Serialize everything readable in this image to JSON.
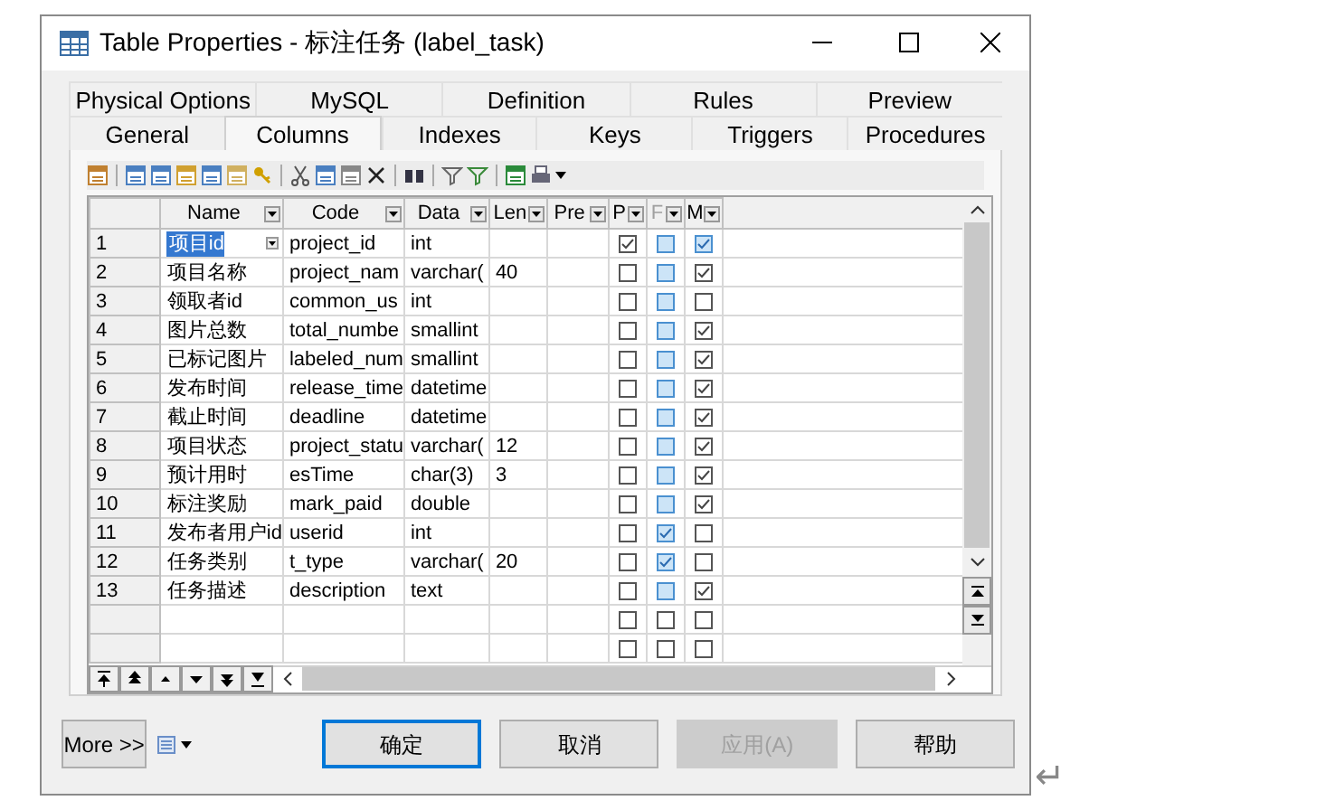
{
  "window": {
    "title": "Table Properties - 标注任务 (label_task)"
  },
  "tabs": [
    [
      {
        "label": "Physical Options",
        "selected": false
      },
      {
        "label": "MySQL",
        "selected": false
      },
      {
        "label": "Definition",
        "selected": false
      },
      {
        "label": "Rules",
        "selected": false
      },
      {
        "label": "Preview",
        "selected": false
      }
    ],
    [
      {
        "label": "General",
        "selected": false
      },
      {
        "label": "Columns",
        "selected": true
      },
      {
        "label": "Indexes",
        "selected": false
      },
      {
        "label": "Keys",
        "selected": false
      },
      {
        "label": "Triggers",
        "selected": false
      },
      {
        "label": "Procedures",
        "selected": false
      }
    ]
  ],
  "table": {
    "columns": [
      {
        "label": "Name",
        "disabled": false
      },
      {
        "label": "Code",
        "disabled": false
      },
      {
        "label": "Data",
        "disabled": false
      },
      {
        "label": "Len",
        "disabled": false
      },
      {
        "label": "Pre",
        "disabled": false
      },
      {
        "label": "P",
        "disabled": false
      },
      {
        "label": "F",
        "disabled": true
      },
      {
        "label": "M",
        "disabled": false
      }
    ],
    "rows": [
      {
        "number": "1",
        "name": "项目id",
        "code": "project_id",
        "data": "int",
        "selected": true,
        "flags": [
          {
            "checked": true,
            "kind": "plain"
          },
          {
            "checked": false,
            "kind": "tinted"
          },
          {
            "checked": true,
            "kind": "tinted"
          }
        ]
      },
      {
        "number": "2",
        "name": "项目名称",
        "code": "project_nam",
        "data": "varchar(",
        "len": "40",
        "selected": false,
        "flags": [
          {
            "checked": false,
            "kind": "plain"
          },
          {
            "checked": false,
            "kind": "tinted"
          },
          {
            "checked": true,
            "kind": "plain"
          }
        ]
      },
      {
        "number": "3",
        "name": "领取者id",
        "code": "common_us",
        "data": "int",
        "selected": false,
        "flags": [
          {
            "checked": false,
            "kind": "plain"
          },
          {
            "checked": false,
            "kind": "tinted"
          },
          {
            "checked": false,
            "kind": "plain"
          }
        ]
      },
      {
        "number": "4",
        "name": "图片总数",
        "code": "total_numbe",
        "data": "smallint",
        "selected": false,
        "flags": [
          {
            "checked": false,
            "kind": "plain"
          },
          {
            "checked": false,
            "kind": "tinted"
          },
          {
            "checked": true,
            "kind": "plain"
          }
        ]
      },
      {
        "number": "5",
        "name": "已标记图片",
        "code": "labeled_num",
        "data": "smallint",
        "selected": false,
        "flags": [
          {
            "checked": false,
            "kind": "plain"
          },
          {
            "checked": false,
            "kind": "tinted"
          },
          {
            "checked": true,
            "kind": "plain"
          }
        ]
      },
      {
        "number": "6",
        "name": "发布时间",
        "code": "release_time",
        "data": "datetime",
        "selected": false,
        "flags": [
          {
            "checked": false,
            "kind": "plain"
          },
          {
            "checked": false,
            "kind": "tinted"
          },
          {
            "checked": true,
            "kind": "plain"
          }
        ]
      },
      {
        "number": "7",
        "name": "截止时间",
        "code": "deadline",
        "data": "datetime",
        "selected": false,
        "flags": [
          {
            "checked": false,
            "kind": "plain"
          },
          {
            "checked": false,
            "kind": "tinted"
          },
          {
            "checked": true,
            "kind": "plain"
          }
        ]
      },
      {
        "number": "8",
        "name": "项目状态",
        "code": "project_statu",
        "data": "varchar(",
        "len": "12",
        "selected": false,
        "flags": [
          {
            "checked": false,
            "kind": "plain"
          },
          {
            "checked": false,
            "kind": "tinted"
          },
          {
            "checked": true,
            "kind": "plain"
          }
        ]
      },
      {
        "number": "9",
        "name": "预计用时",
        "code": "esTime",
        "data": "char(3)",
        "len": "3",
        "selected": false,
        "flags": [
          {
            "checked": false,
            "kind": "plain"
          },
          {
            "checked": false,
            "kind": "tinted"
          },
          {
            "checked": true,
            "kind": "plain"
          }
        ]
      },
      {
        "number": "10",
        "name": "标注奖励",
        "code": "mark_paid",
        "data": "double",
        "selected": false,
        "flags": [
          {
            "checked": false,
            "kind": "plain"
          },
          {
            "checked": false,
            "kind": "tinted"
          },
          {
            "checked": true,
            "kind": "plain"
          }
        ]
      },
      {
        "number": "11",
        "name": "发布者用户id",
        "code": "userid",
        "data": "int",
        "selected": false,
        "flags": [
          {
            "checked": false,
            "kind": "plain"
          },
          {
            "checked": true,
            "kind": "tinted"
          },
          {
            "checked": false,
            "kind": "plain"
          }
        ]
      },
      {
        "number": "12",
        "name": "任务类别",
        "code": "t_type",
        "data": "varchar(",
        "len": "20",
        "selected": false,
        "flags": [
          {
            "checked": false,
            "kind": "plain"
          },
          {
            "checked": true,
            "kind": "tinted"
          },
          {
            "checked": false,
            "kind": "plain"
          }
        ]
      },
      {
        "number": "13",
        "name": "任务描述",
        "code": "description",
        "data": "text",
        "selected": false,
        "flags": [
          {
            "checked": false,
            "kind": "plain"
          },
          {
            "checked": false,
            "kind": "tinted"
          },
          {
            "checked": true,
            "kind": "plain"
          }
        ]
      },
      {
        "selected": false,
        "flags": [
          {
            "checked": false,
            "kind": "plain"
          },
          {
            "checked": false,
            "kind": "plain"
          },
          {
            "checked": false,
            "kind": "plain"
          }
        ]
      },
      {
        "selected": false,
        "flags": [
          {
            "checked": false,
            "kind": "plain"
          },
          {
            "checked": false,
            "kind": "plain"
          },
          {
            "checked": false,
            "kind": "plain"
          }
        ]
      }
    ]
  },
  "buttons": [
    {
      "label": "More >>",
      "kind": "more",
      "disabled": false
    },
    {
      "label": "确定",
      "kind": "default",
      "disabled": false
    },
    {
      "label": "取消",
      "kind": "normal",
      "disabled": false
    },
    {
      "label": "应用(A)",
      "kind": "normal",
      "disabled": true
    },
    {
      "label": "帮助",
      "kind": "normal",
      "disabled": false
    }
  ],
  "return_mark": "↵"
}
